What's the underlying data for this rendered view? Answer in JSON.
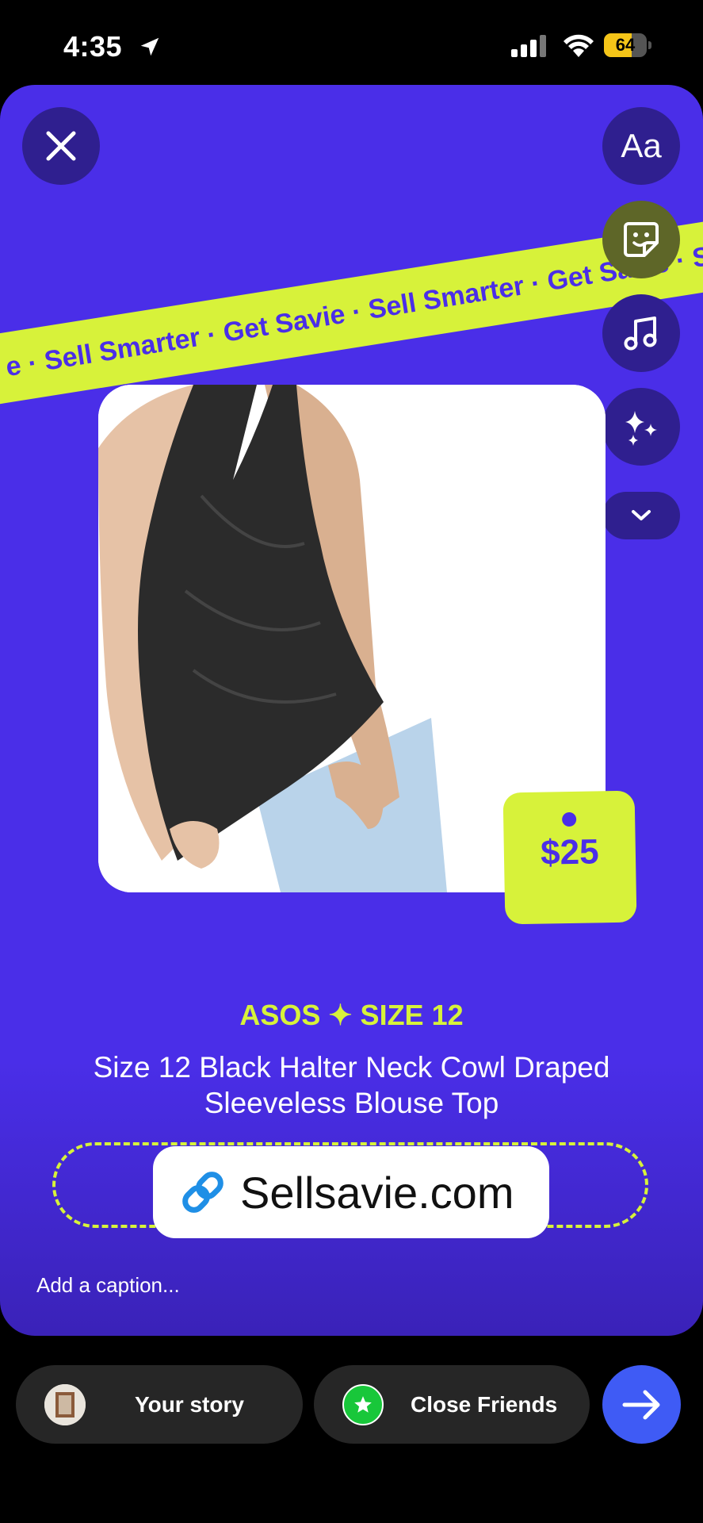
{
  "status_bar": {
    "time": "4:35",
    "battery": "64",
    "battery_level": 0.64
  },
  "editor": {
    "text_tool_label": "Aa",
    "icons": [
      "close-icon",
      "sticker-icon",
      "music-note-icon",
      "sparkles-icon",
      "chevron-down-icon"
    ]
  },
  "banner": {
    "text": "e · Sell Smarter · Get Savie · Sell Smarter · Get Savie · Se"
  },
  "product": {
    "price": "$25",
    "brand_size": "ASOS ✦ SIZE 12",
    "title": "Size 12 Black Halter Neck Cowl Draped Sleeveless Blouse Top"
  },
  "link_sticker": {
    "text": "Sellsavie.com"
  },
  "caption": {
    "placeholder": "Add a caption..."
  },
  "share": {
    "your_story": "Your story",
    "close_friends": "Close Friends"
  },
  "colors": {
    "canvas": "#4a2ee8",
    "accent": "#d7f23a",
    "send": "#3f5bf5"
  }
}
